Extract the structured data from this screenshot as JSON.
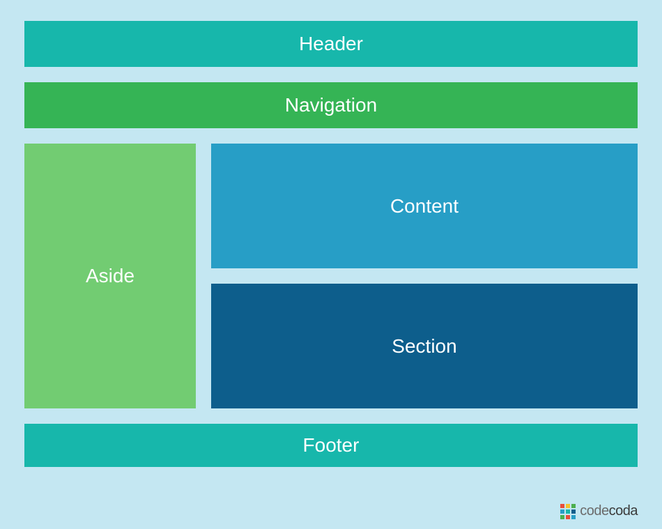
{
  "regions": {
    "header": "Header",
    "nav": "Navigation",
    "aside": "Aside",
    "content": "Content",
    "section": "Section",
    "footer": "Footer"
  },
  "brand": {
    "name_part1": "code",
    "name_part2": "coda"
  },
  "colors": {
    "page_bg": "#c4e7f2",
    "header": "#17b7ab",
    "nav": "#35b455",
    "aside": "#72cc72",
    "content": "#279ec6",
    "section": "#0d5e8c",
    "footer": "#17b7ab"
  }
}
